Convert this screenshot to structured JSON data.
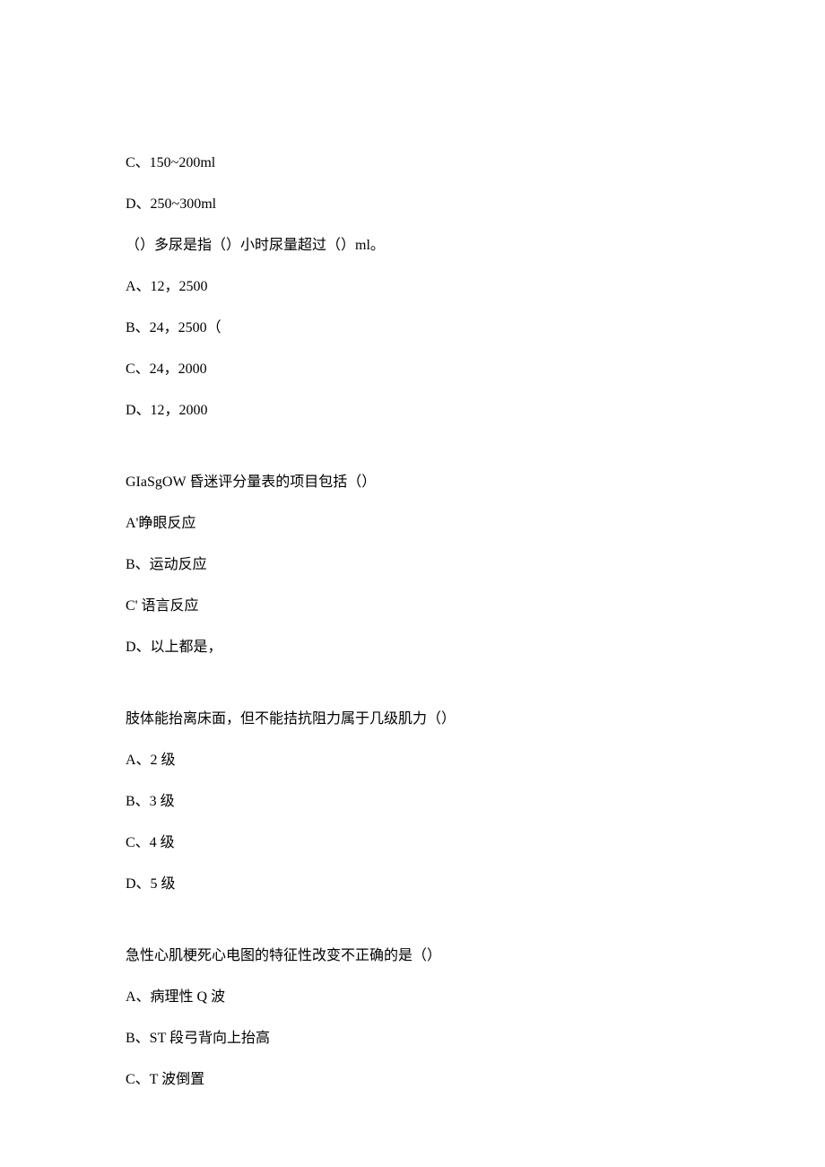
{
  "q1": {
    "optC": "C、150~200ml",
    "optD": "D、250~300ml"
  },
  "q2": {
    "stem": "（）多尿是指（）小时尿量超过（）ml。",
    "optA": "A、12，2500",
    "optB": "B、24，2500（",
    "optC": "C、24，2000",
    "optD": "D、12，2000"
  },
  "q3": {
    "stem": "GIaSgOW 昏迷评分量表的项目包括（）",
    "optA": "A'睁眼反应",
    "optB": "B、运动反应",
    "optC": "C' 语言反应",
    "optD": "D、以上都是，"
  },
  "q4": {
    "stem": "肢体能抬离床面，但不能拮抗阻力属于几级肌力（）",
    "optA": "A、2 级",
    "optB": "B、3 级",
    "optC": "C、4 级",
    "optD": "D、5 级"
  },
  "q5": {
    "stem": "急性心肌梗死心电图的特征性改变不正确的是（）",
    "optA": "A、病理性 Q 波",
    "optB": "B、ST 段弓背向上抬高",
    "optC": "C、T 波倒置"
  }
}
